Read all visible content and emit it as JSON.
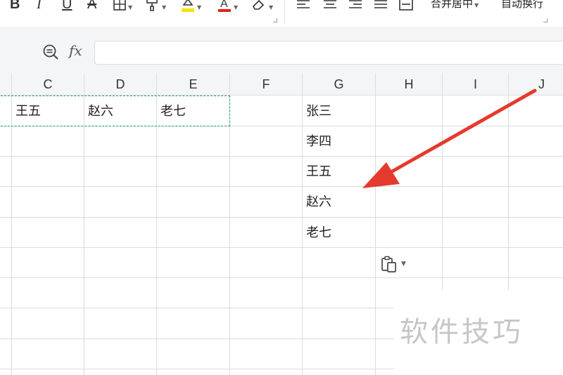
{
  "ribbon": {
    "merge_center_label": "合并居中",
    "wrap_text_label": "自动换行"
  },
  "formula_bar": {
    "fx_label": "fx",
    "content": ""
  },
  "columns": [
    "C",
    "D",
    "E",
    "F",
    "G",
    "H",
    "I",
    "J"
  ],
  "copied_row": [
    "王五",
    "赵六",
    "老七"
  ],
  "pasted_column": [
    "张三",
    "李四",
    "王五",
    "赵六",
    "老七"
  ],
  "watermark": "软件技巧",
  "colors": {
    "accent_green": "#1e9b6f",
    "arrow_red": "#e53a2e",
    "highlight_yellow": "#f5e400",
    "font_red": "#e02020"
  },
  "icons": [
    "bold-icon",
    "italic-icon",
    "underline-icon",
    "strikethrough-icon",
    "border-icon",
    "format-painter-icon",
    "fill-color-icon",
    "font-color-icon",
    "clear-format-icon",
    "align-left-icon",
    "align-center-icon",
    "align-right-icon",
    "justify-icon",
    "distributed-icon",
    "zoom-icon",
    "paste-options-icon"
  ]
}
